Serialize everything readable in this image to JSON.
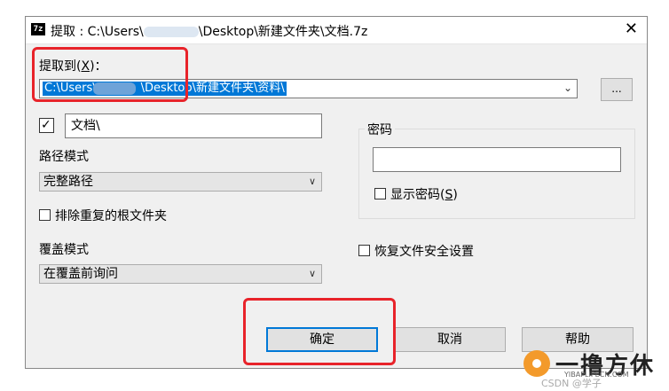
{
  "window": {
    "app_icon": "7z",
    "title": "提取 : C:\\Users\\",
    "title_tail": "\\Desktop\\新建文件夹\\文档.7z",
    "close": "✕"
  },
  "extract_to": {
    "label": "提取到(",
    "label_accel": "X",
    "label_end": ")：",
    "path_head": "C:\\Users\\",
    "path_tail": "\\Desktop\\新建文件夹\\资料\\",
    "dropdown_arrow": "⌄",
    "browse_label": "..."
  },
  "subfolder": {
    "checked": true,
    "value": "文档\\"
  },
  "path_mode": {
    "label": "路径模式",
    "selected": "完整路径"
  },
  "eliminate_duplicates": {
    "label": "排除重复的根文件夹",
    "checked": false
  },
  "overwrite_mode": {
    "label": "覆盖模式",
    "selected": "在覆盖前询问"
  },
  "password": {
    "group_label": "密码",
    "value": "",
    "show_label": "显示密码(",
    "show_accel": "S",
    "show_end": ")",
    "show_checked": false
  },
  "restore_security": {
    "label": "恢复文件安全设置",
    "checked": false
  },
  "buttons": {
    "ok": "确定",
    "cancel": "取消",
    "help": "帮助"
  },
  "watermark": {
    "brand": "一撸方休",
    "url": "YIBAPLIPECN.COM",
    "csdn": "CSDN @学子"
  },
  "colors": {
    "accent": "#0078d7",
    "highlight_box": "#e8232a",
    "dialog_bg": "#f0f0f0"
  }
}
